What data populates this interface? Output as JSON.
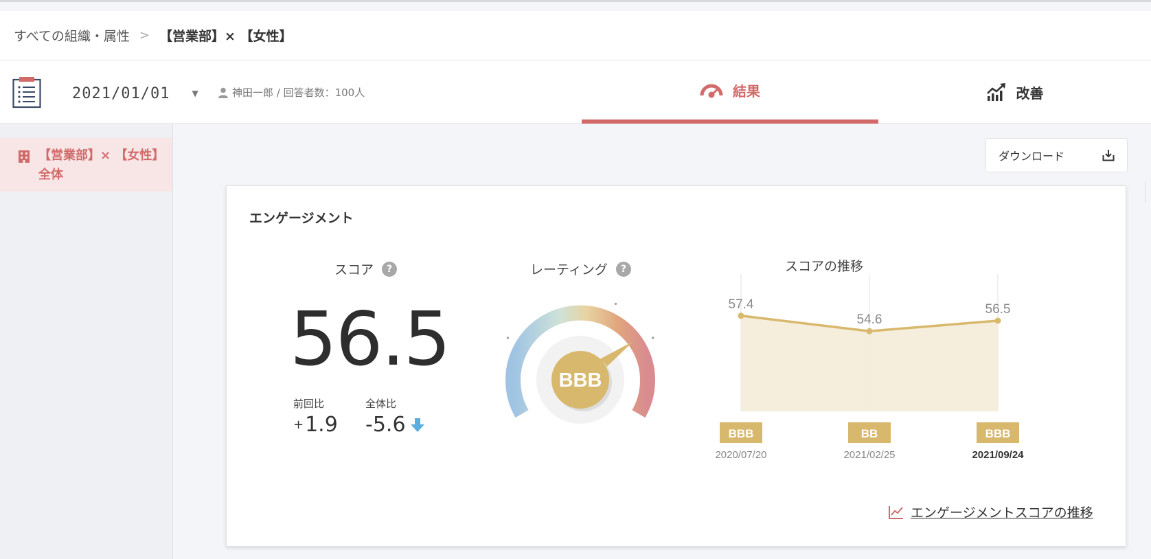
{
  "breadcrumb": {
    "root": "すべての組織・属性",
    "separator": ">",
    "current": "【営業部】× 【女性】"
  },
  "toolbar": {
    "date": "2021/01/01",
    "meta": "神田一郎 / 回答者数：100人",
    "icons": {
      "survey": "clipboard-list-icon",
      "user": "person-icon",
      "caret": "caret-down-icon"
    }
  },
  "tabs": {
    "results": {
      "label": "結果",
      "icon": "gauge-icon",
      "active": true
    },
    "improve": {
      "label": "改善",
      "icon": "trend-up-icon",
      "active": false
    }
  },
  "sidebar": {
    "item": {
      "line1": "【営業部】× 【女性】",
      "line2": "全体",
      "icon": "building-icon"
    }
  },
  "download": {
    "label": "ダウンロード",
    "icon": "download-icon"
  },
  "colors": {
    "accent": "#d26a6a",
    "gold": "#d8b86c",
    "blue_arrow": "#5aaee0",
    "area_fill": "#f5ecd9"
  },
  "engagement": {
    "title": "エンゲージメント",
    "score": {
      "label": "スコア",
      "help": "?",
      "value": "56.5",
      "prev_label": "前回比",
      "prev_sign": "+",
      "prev_value": "1.9",
      "overall_label": "全体比",
      "overall_value": "-5.6",
      "overall_icon": "arrow-down-icon"
    },
    "rating": {
      "label": "レーティング",
      "help": "?",
      "value": "BBB",
      "level": 0.68
    },
    "trend": {
      "title": "スコアの推移"
    },
    "link": {
      "label": "エンゲージメントスコアの推移",
      "icon": "line-chart-icon"
    }
  },
  "chart_data": {
    "type": "area",
    "title": "スコアの推移",
    "categories": [
      "2020/07/20",
      "2021/02/25",
      "2021/09/24"
    ],
    "ratings": [
      "BBB",
      "BB",
      "BBB"
    ],
    "values": [
      57.4,
      54.6,
      56.5
    ],
    "highlighted_category": "2021/09/24",
    "ylim": [
      40,
      65
    ],
    "grid": "vertical lines at each category",
    "legend": "none"
  }
}
